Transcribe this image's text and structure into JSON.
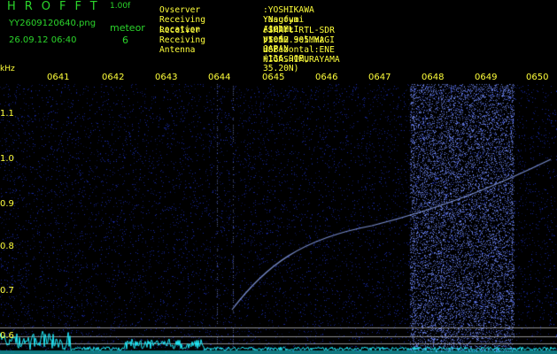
{
  "header": {
    "app_title": "HROFFT",
    "version": "1.00f",
    "file_name": "YY2609120640.png",
    "datetime": "26.09.12 06:40",
    "meteor_label": "meteor",
    "meteor_count": "6"
  },
  "info": [
    {
      "key": "Ovserver",
      "value": ":YOSHIKAWA Yasufumi /JG2MLI"
    },
    {
      "key": "Receiving Location",
      "value": ":Nagoya Aichi-pref. JAPAN (136.90E, 35.20N)"
    },
    {
      "key": "Receiver",
      "value": ":SMArt RTL-SDR V5 52.905MHz USB HIGASHIMURAYAMA"
    },
    {
      "key": "Receiving Antenna",
      "value": ":10mH 3el.YAGI Horizontal:ENE"
    }
  ],
  "axes": {
    "y_unit": "kHz",
    "y_ticks": [
      "1.1",
      "1.0",
      "0.9",
      "0.8",
      "0.7",
      "0.6"
    ],
    "x_ticks": [
      "0641",
      "0642",
      "0643",
      "0644",
      "0645",
      "0646",
      "0647",
      "0648",
      "0649",
      "0650"
    ]
  },
  "colors": {
    "title_green": "#2bd62b",
    "label_yellow": "#ffff3a",
    "background": "#000000",
    "noise_blue": "#2a3fd0",
    "signal_light": "#c8d8ff",
    "cyan_trace": "#20f0ff"
  }
}
